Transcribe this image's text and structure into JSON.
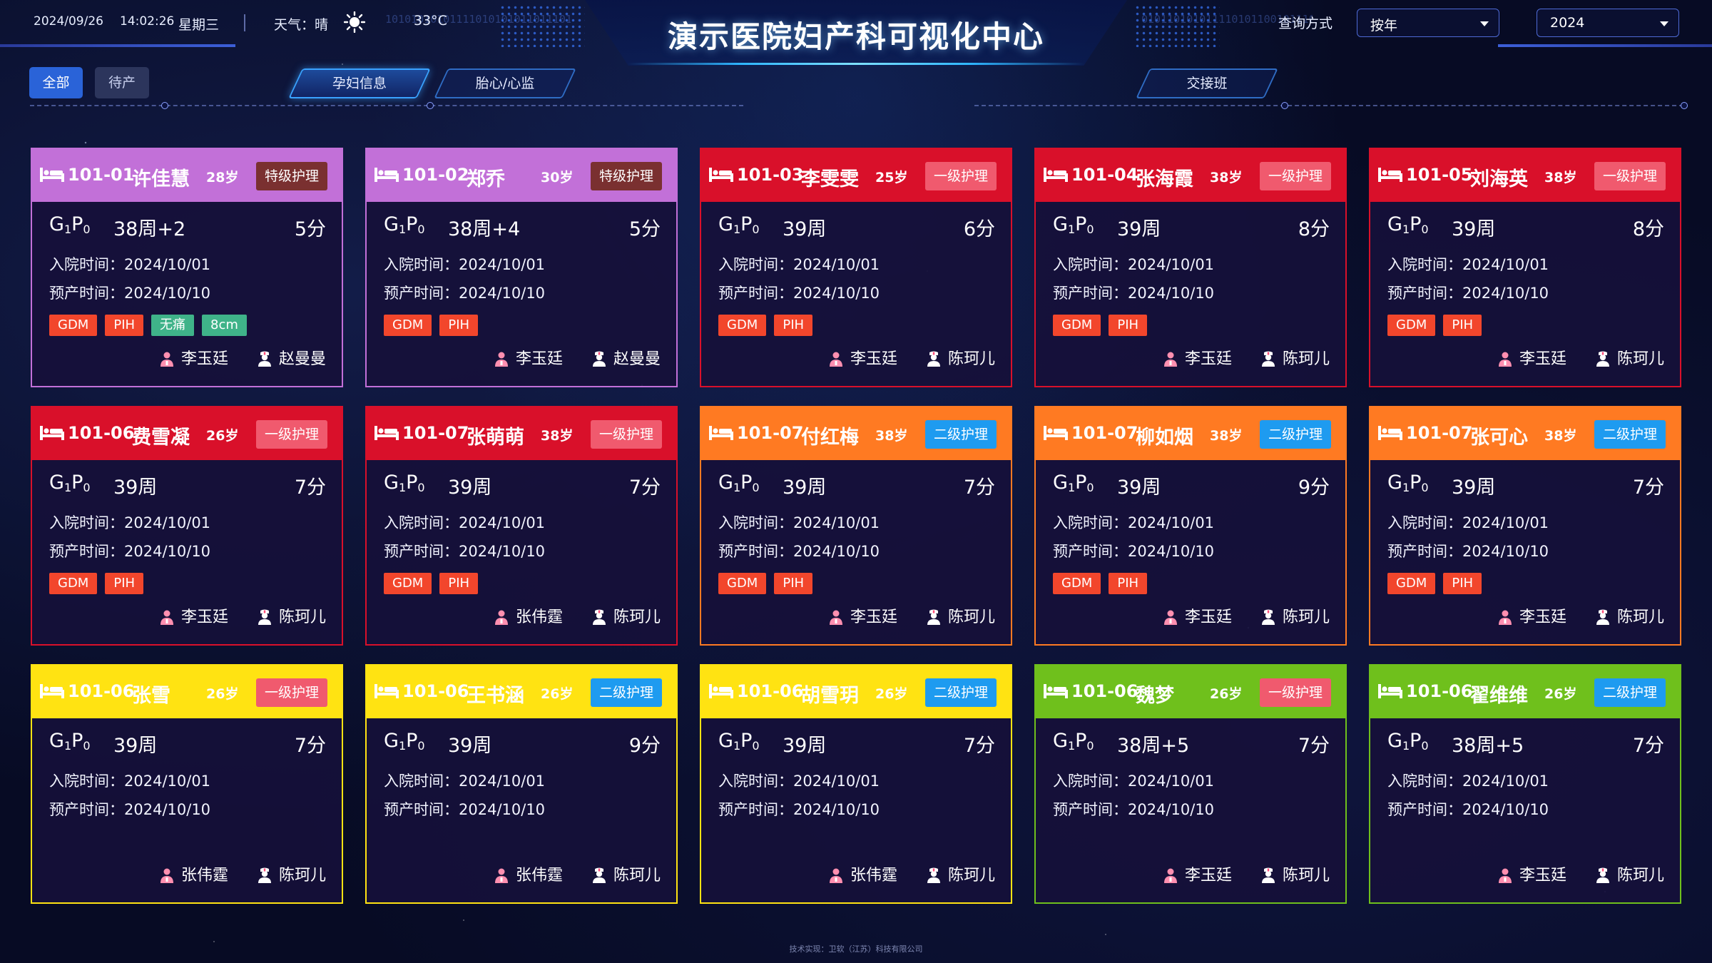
{
  "header": {
    "date": "2024/09/26",
    "time": "14:02:26",
    "weekday": "星期三",
    "weather_label": "天气：晴",
    "weather_icon": "sun-icon",
    "temperature": "33°C",
    "title": "演示医院妇产科可视化中心",
    "query_label": "查询方式",
    "query_mode": "按年",
    "year": "2024"
  },
  "filters": [
    {
      "label": "全部",
      "active": true
    },
    {
      "label": "待产",
      "active": false
    }
  ],
  "tabs": [
    {
      "label": "孕妇信息",
      "active": true
    },
    {
      "label": "胎心/心监",
      "active": false
    },
    {
      "label": "交接班",
      "active": false
    }
  ],
  "colors": {
    "purple": "#c270d8",
    "red": "#d9102a",
    "orange": "#ff7a22",
    "yellow": "#ffe312",
    "green": "#6fc01c",
    "level_special": "#7a3030",
    "level_first": "#f05a6e",
    "level_second": "#1e9bf0"
  },
  "labels": {
    "admit": "入院时间：",
    "due": "预产时间："
  },
  "patients": [
    {
      "room": "101-01",
      "name": "许佳慧",
      "age": "28岁",
      "level": "特级护理",
      "level_color": "#7a3030",
      "header_color": "#c270d8",
      "text_dark": false,
      "gp_g": "G",
      "gp_gn": "1",
      "gp_p": "P",
      "gp_pn": "0",
      "weeks": "38周+2",
      "score": "5分",
      "admit": "2024/10/01",
      "due": "2024/10/10",
      "tags": [
        {
          "text": "GDM",
          "color": "red"
        },
        {
          "text": "PIH",
          "color": "red"
        },
        {
          "text": "无痛",
          "color": "green"
        },
        {
          "text": "8cm",
          "color": "green"
        }
      ],
      "doctor": "李玉廷",
      "nurse": "赵曼曼"
    },
    {
      "room": "101-02",
      "name": "郑乔",
      "age": "30岁",
      "level": "特级护理",
      "level_color": "#7a3030",
      "header_color": "#c270d8",
      "text_dark": false,
      "gp_g": "G",
      "gp_gn": "1",
      "gp_p": "P",
      "gp_pn": "0",
      "weeks": "38周+4",
      "score": "5分",
      "admit": "2024/10/01",
      "due": "2024/10/10",
      "tags": [
        {
          "text": "GDM",
          "color": "red"
        },
        {
          "text": "PIH",
          "color": "red"
        }
      ],
      "doctor": "李玉廷",
      "nurse": "赵曼曼"
    },
    {
      "room": "101-03",
      "name": "李雯雯",
      "age": "25岁",
      "level": "一级护理",
      "level_color": "#f05a6e",
      "header_color": "#d9102a",
      "text_dark": false,
      "gp_g": "G",
      "gp_gn": "1",
      "gp_p": "P",
      "gp_pn": "0",
      "weeks": "39周",
      "score": "6分",
      "admit": "2024/10/01",
      "due": "2024/10/10",
      "tags": [
        {
          "text": "GDM",
          "color": "red"
        },
        {
          "text": "PIH",
          "color": "red"
        }
      ],
      "doctor": "李玉廷",
      "nurse": "陈珂儿"
    },
    {
      "room": "101-04",
      "name": "张海霞",
      "age": "38岁",
      "level": "一级护理",
      "level_color": "#f05a6e",
      "header_color": "#d9102a",
      "text_dark": false,
      "gp_g": "G",
      "gp_gn": "1",
      "gp_p": "P",
      "gp_pn": "0",
      "weeks": "39周",
      "score": "8分",
      "admit": "2024/10/01",
      "due": "2024/10/10",
      "tags": [
        {
          "text": "GDM",
          "color": "red"
        },
        {
          "text": "PIH",
          "color": "red"
        }
      ],
      "doctor": "李玉廷",
      "nurse": "陈珂儿"
    },
    {
      "room": "101-05",
      "name": "刘海英",
      "age": "38岁",
      "level": "一级护理",
      "level_color": "#f05a6e",
      "header_color": "#d9102a",
      "text_dark": false,
      "gp_g": "G",
      "gp_gn": "1",
      "gp_p": "P",
      "gp_pn": "0",
      "weeks": "39周",
      "score": "8分",
      "admit": "2024/10/01",
      "due": "2024/10/10",
      "tags": [
        {
          "text": "GDM",
          "color": "red"
        },
        {
          "text": "PIH",
          "color": "red"
        }
      ],
      "doctor": "李玉廷",
      "nurse": "陈珂儿"
    },
    {
      "room": "101-06",
      "name": "费雪凝",
      "age": "26岁",
      "level": "一级护理",
      "level_color": "#f05a6e",
      "header_color": "#d9102a",
      "text_dark": false,
      "gp_g": "G",
      "gp_gn": "1",
      "gp_p": "P",
      "gp_pn": "0",
      "weeks": "39周",
      "score": "7分",
      "admit": "2024/10/01",
      "due": "2024/10/10",
      "tags": [
        {
          "text": "GDM",
          "color": "red"
        },
        {
          "text": "PIH",
          "color": "red"
        }
      ],
      "doctor": "李玉廷",
      "nurse": "陈珂儿"
    },
    {
      "room": "101-07",
      "name": "张萌萌",
      "age": "38岁",
      "level": "一级护理",
      "level_color": "#f05a6e",
      "header_color": "#d9102a",
      "text_dark": false,
      "gp_g": "G",
      "gp_gn": "1",
      "gp_p": "P",
      "gp_pn": "0",
      "weeks": "39周",
      "score": "7分",
      "admit": "2024/10/01",
      "due": "2024/10/10",
      "tags": [
        {
          "text": "GDM",
          "color": "red"
        },
        {
          "text": "PIH",
          "color": "red"
        }
      ],
      "doctor": "张伟霆",
      "nurse": "陈珂儿"
    },
    {
      "room": "101-07",
      "name": "付红梅",
      "age": "38岁",
      "level": "二级护理",
      "level_color": "#1e9bf0",
      "header_color": "#ff7a22",
      "text_dark": false,
      "gp_g": "G",
      "gp_gn": "1",
      "gp_p": "P",
      "gp_pn": "0",
      "weeks": "39周",
      "score": "7分",
      "admit": "2024/10/01",
      "due": "2024/10/10",
      "tags": [
        {
          "text": "GDM",
          "color": "red"
        },
        {
          "text": "PIH",
          "color": "red"
        }
      ],
      "doctor": "李玉廷",
      "nurse": "陈珂儿"
    },
    {
      "room": "101-07",
      "name": "柳如烟",
      "age": "38岁",
      "level": "二级护理",
      "level_color": "#1e9bf0",
      "header_color": "#ff7a22",
      "text_dark": false,
      "gp_g": "G",
      "gp_gn": "1",
      "gp_p": "P",
      "gp_pn": "0",
      "weeks": "39周",
      "score": "9分",
      "admit": "2024/10/01",
      "due": "2024/10/10",
      "tags": [
        {
          "text": "GDM",
          "color": "red"
        },
        {
          "text": "PIH",
          "color": "red"
        }
      ],
      "doctor": "李玉廷",
      "nurse": "陈珂儿"
    },
    {
      "room": "101-07",
      "name": "张可心",
      "age": "38岁",
      "level": "二级护理",
      "level_color": "#1e9bf0",
      "header_color": "#ff7a22",
      "text_dark": false,
      "gp_g": "G",
      "gp_gn": "1",
      "gp_p": "P",
      "gp_pn": "0",
      "weeks": "39周",
      "score": "7分",
      "admit": "2024/10/01",
      "due": "2024/10/10",
      "tags": [
        {
          "text": "GDM",
          "color": "red"
        },
        {
          "text": "PIH",
          "color": "red"
        }
      ],
      "doctor": "李玉廷",
      "nurse": "陈珂儿"
    },
    {
      "room": "101-06",
      "name": "张雪",
      "age": "26岁",
      "level": "一级护理",
      "level_color": "#f05a6e",
      "header_color": "#ffe312",
      "text_dark": false,
      "gp_g": "G",
      "gp_gn": "1",
      "gp_p": "P",
      "gp_pn": "0",
      "weeks": "39周",
      "score": "7分",
      "admit": "2024/10/01",
      "due": "2024/10/10",
      "tags": [],
      "doctor": "张伟霆",
      "nurse": "陈珂儿"
    },
    {
      "room": "101-06",
      "name": "王书涵",
      "age": "26岁",
      "level": "二级护理",
      "level_color": "#1e9bf0",
      "header_color": "#ffe312",
      "text_dark": false,
      "gp_g": "G",
      "gp_gn": "1",
      "gp_p": "P",
      "gp_pn": "0",
      "weeks": "39周",
      "score": "9分",
      "admit": "2024/10/01",
      "due": "2024/10/10",
      "tags": [],
      "doctor": "张伟霆",
      "nurse": "陈珂儿"
    },
    {
      "room": "101-06",
      "name": "胡雪玥",
      "age": "26岁",
      "level": "二级护理",
      "level_color": "#1e9bf0",
      "header_color": "#ffe312",
      "text_dark": false,
      "gp_g": "G",
      "gp_gn": "1",
      "gp_p": "P",
      "gp_pn": "0",
      "weeks": "39周",
      "score": "7分",
      "admit": "2024/10/01",
      "due": "2024/10/10",
      "tags": [],
      "doctor": "张伟霆",
      "nurse": "陈珂儿"
    },
    {
      "room": "101-06",
      "name": "魏梦",
      "age": "26岁",
      "level": "一级护理",
      "level_color": "#f05a6e",
      "header_color": "#6fc01c",
      "text_dark": false,
      "gp_g": "G",
      "gp_gn": "1",
      "gp_p": "P",
      "gp_pn": "0",
      "weeks": "38周+5",
      "score": "7分",
      "admit": "2024/10/01",
      "due": "2024/10/10",
      "tags": [],
      "doctor": "李玉廷",
      "nurse": "陈珂儿"
    },
    {
      "room": "101-06",
      "name": "翟维维",
      "age": "26岁",
      "level": "二级护理",
      "level_color": "#1e9bf0",
      "header_color": "#6fc01c",
      "text_dark": false,
      "gp_g": "G",
      "gp_gn": "1",
      "gp_p": "P",
      "gp_pn": "0",
      "weeks": "38周+5",
      "score": "7分",
      "admit": "2024/10/01",
      "due": "2024/10/10",
      "tags": [],
      "doctor": "李玉廷",
      "nurse": "陈珂儿"
    }
  ],
  "footer": "技术实现：卫软（江苏）科技有限公司"
}
